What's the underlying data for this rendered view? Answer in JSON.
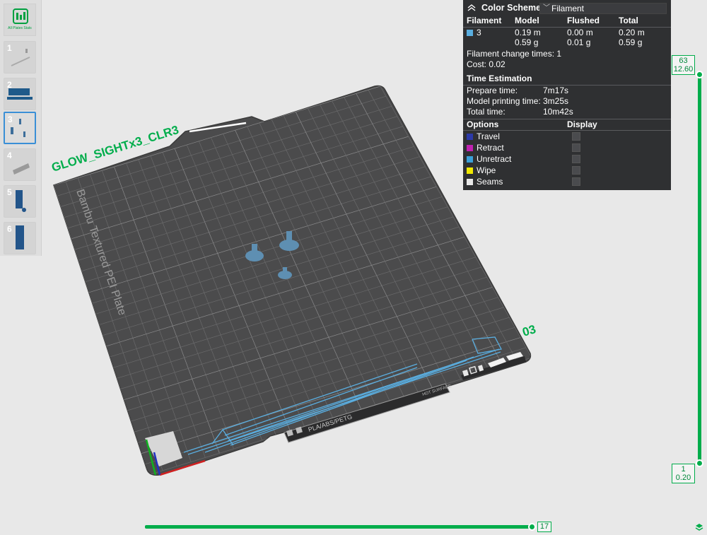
{
  "sidebar": {
    "all_plates_label": "All Plates Stats",
    "plates": [
      "1",
      "2",
      "3",
      "4",
      "5",
      "6"
    ],
    "selected_plate": "3"
  },
  "scene": {
    "plate_name": "GLOW_SIGHTx3_CLR3",
    "plate_brand": "Bambu Textured PEI Plate",
    "plate_number": "03",
    "material_label": "PLA/ABS/PETG",
    "surface_label": "HOT SURFACE"
  },
  "panel": {
    "title": "Color Scheme",
    "scheme_value": "Filament",
    "table_headers": [
      "Filament",
      "Model",
      "Flushed",
      "Total"
    ],
    "filament": {
      "id": "3",
      "color": "#5aaee0",
      "model_length": "0.19 m",
      "model_weight": "0.59 g",
      "flushed_length": "0.00 m",
      "flushed_weight": "0.01 g",
      "total_length": "0.20 m",
      "total_weight": "0.59 g"
    },
    "change_times_label": "Filament change times:",
    "change_times_value": "1",
    "cost_label": "Cost:",
    "cost_value": "0.02",
    "time_section": "Time Estimation",
    "prepare_label": "Prepare time:",
    "prepare_value": "7m17s",
    "model_time_label": "Model printing time:",
    "model_time_value": "3m25s",
    "total_label": "Total time:",
    "total_value": "10m42s",
    "options_header": "Options",
    "display_header": "Display",
    "options": [
      {
        "label": "Travel",
        "color": "#2c3aa8"
      },
      {
        "label": "Retract",
        "color": "#c021b0"
      },
      {
        "label": "Unretract",
        "color": "#3aa0d8"
      },
      {
        "label": "Wipe",
        "color": "#f0e800"
      },
      {
        "label": "Seams",
        "color": "#e8e8e8"
      }
    ]
  },
  "vslider": {
    "top_layer": "63",
    "top_height": "12.60",
    "bottom_layer": "1",
    "bottom_height": "0.20"
  },
  "hslider": {
    "value": "17"
  },
  "colors": {
    "accent": "#00ad4b",
    "plate": "#4a4a4b",
    "toolpath": "#5aaee0"
  }
}
